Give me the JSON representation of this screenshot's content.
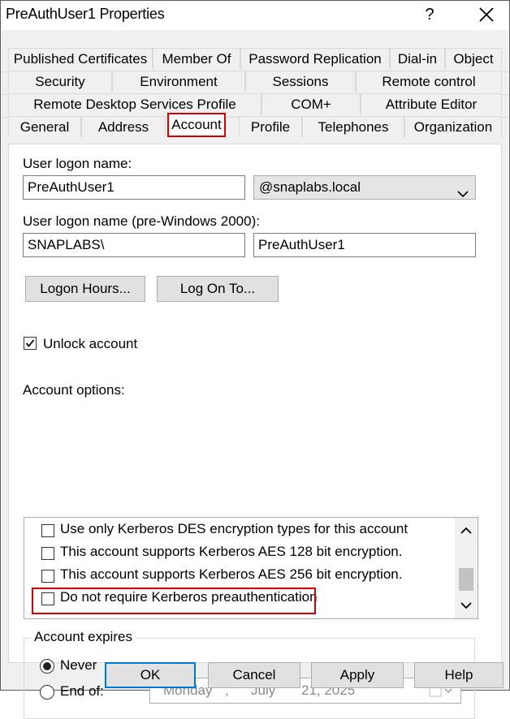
{
  "window": {
    "title": "PreAuthUser1 Properties",
    "help_glyph": "?"
  },
  "tabs": {
    "row1": [
      "Published Certificates",
      "Member Of",
      "Password Replication",
      "Dial-in",
      "Object"
    ],
    "row2": [
      "Security",
      "Environment",
      "Sessions",
      "Remote control"
    ],
    "row3": [
      "Remote Desktop Services Profile",
      "COM+",
      "Attribute Editor"
    ],
    "row4": [
      "General",
      "Address",
      "Account",
      "Profile",
      "Telephones",
      "Organization"
    ],
    "selected": "Account"
  },
  "account": {
    "logon_name_label": "User logon name:",
    "logon_name_value": "PreAuthUser1",
    "domain_suffix": "@snaplabs.local",
    "pre2000_label": "User logon name (pre-Windows 2000):",
    "pre2000_domain": "SNAPLABS\\",
    "pre2000_user": "PreAuthUser1",
    "logon_hours_button": "Logon Hours...",
    "logon_to_button": "Log On To...",
    "unlock_label": "Unlock account",
    "unlock_checked": true,
    "options_label": "Account options:",
    "options": [
      {
        "label": "Use only Kerberos DES encryption types for this account",
        "checked": false
      },
      {
        "label": "This account supports Kerberos AES 128 bit encryption.",
        "checked": false
      },
      {
        "label": "This account supports Kerberos AES 256 bit encryption.",
        "checked": false
      },
      {
        "label": "Do not require Kerberos preauthentication",
        "checked": false
      }
    ],
    "expires": {
      "caption": "Account expires",
      "never_label": "Never",
      "end_of_label": "End of:",
      "selected": "Never",
      "date_weekday": "Monday",
      "date_sep1": ",",
      "date_month": "July",
      "date_day_year": "21, 2025"
    }
  },
  "footer": {
    "ok": "OK",
    "cancel": "Cancel",
    "apply": "Apply",
    "help": "Help"
  },
  "colors": {
    "highlight": "#d50000",
    "default_button_border": "#0078d7"
  }
}
